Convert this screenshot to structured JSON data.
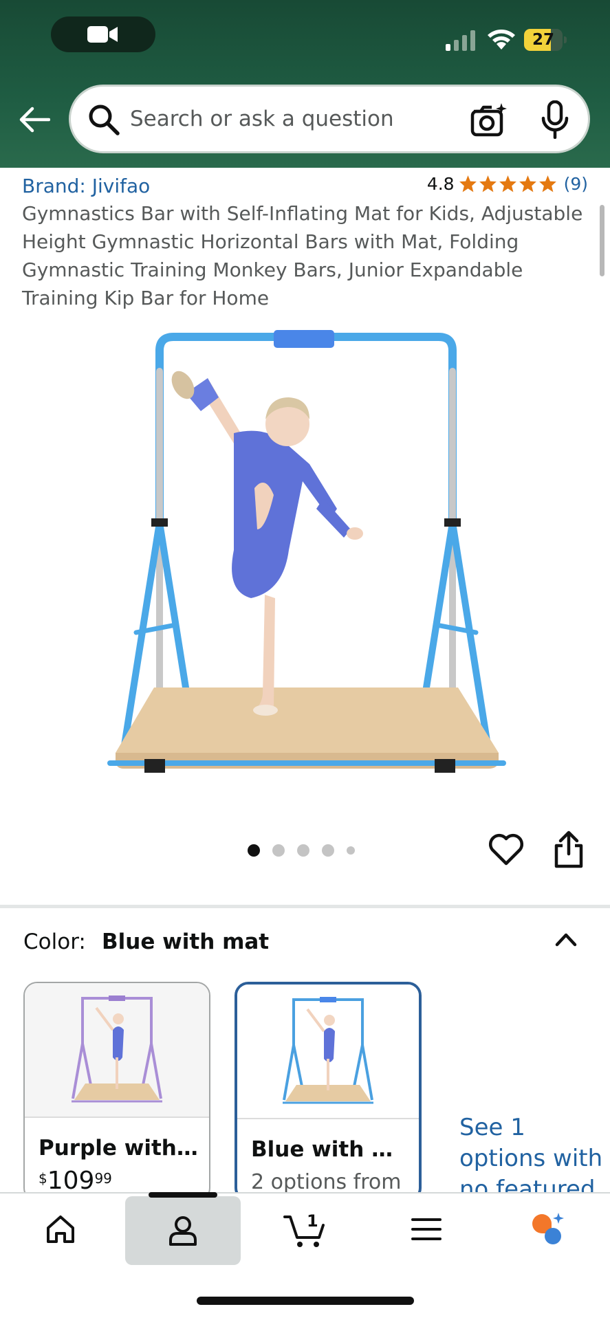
{
  "status_bar": {
    "battery_level": "27",
    "battery_fraction": 0.7
  },
  "search": {
    "placeholder": "Search or ask a question"
  },
  "product": {
    "brand": "Brand: Jivifao",
    "rating_value": "4.8",
    "rating_stars": 5,
    "rating_count": "(9)",
    "title": "Gymnastics Bar with Self-Inflating Mat for Kids, Adjustable Height Gymnastic Horizontal Bars with Mat, Folding Gymnastic Training Monkey Bars, Junior Expandable Training Kip Bar for Home",
    "image_count": 5,
    "active_image_index": 0
  },
  "color_selector": {
    "label": "Color:",
    "selected_value": "Blue with mat",
    "swatches": [
      {
        "name": "Purple with ...",
        "price_symbol": "$",
        "price_whole": "109",
        "price_fraction": "99",
        "frame_color": "#a98ed6",
        "selected": false
      },
      {
        "name": "Blue with mat",
        "subtext": "2 options from",
        "frame_color": "#4aa0e0",
        "selected": true
      }
    ],
    "see_more": "See 1 options with no featured"
  },
  "colors": {
    "link": "#2162a1",
    "star": "#e47911",
    "header_dark": "#184a35",
    "selected_border": "#2c5f99",
    "frame_blue": "#4aa8e8",
    "mat": "#e6cba3"
  },
  "tabbar": {
    "active": "account",
    "cart_count": "1",
    "items": [
      "home-icon",
      "account-icon",
      "cart-icon",
      "menu-icon",
      "rufus-icon"
    ]
  }
}
